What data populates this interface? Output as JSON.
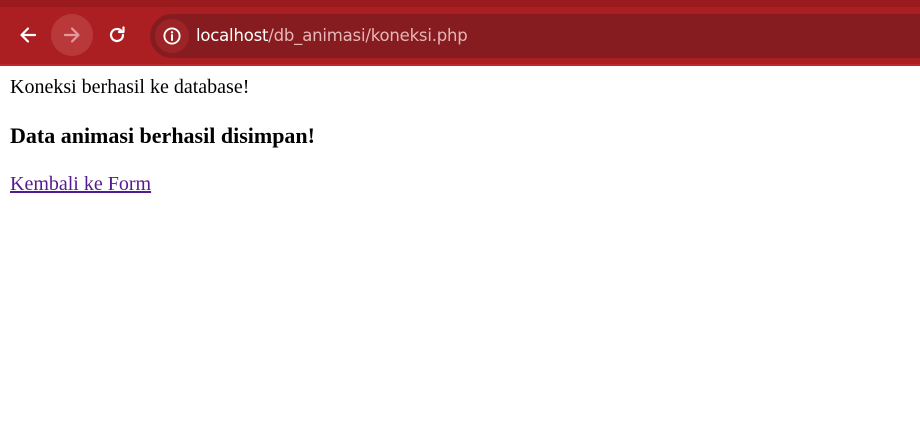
{
  "browser": {
    "url_host": "localhost",
    "url_path": "/db_animasi/koneksi.php",
    "icons": {
      "back": "back-arrow-icon",
      "forward": "forward-arrow-icon",
      "reload": "reload-icon",
      "site_info": "info-icon"
    },
    "colors": {
      "toolbar": "#ab1e22",
      "omnibox": "#861c20"
    }
  },
  "page": {
    "status_message": "Koneksi berhasil ke database!",
    "heading": "Data animasi berhasil disimpan!",
    "back_link_label": "Kembali ke Form",
    "colors": {
      "link_visited": "#551a8b"
    }
  }
}
